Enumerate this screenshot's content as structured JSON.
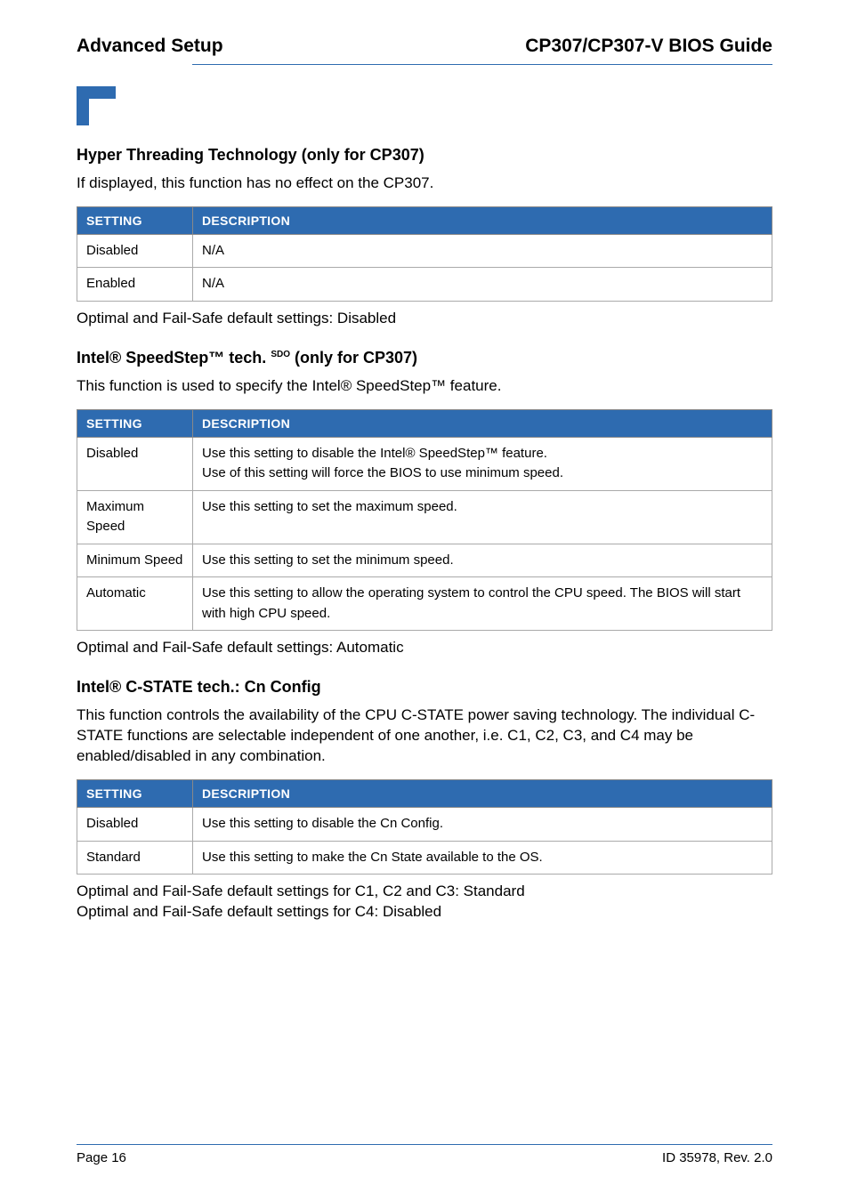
{
  "header": {
    "left": "Advanced Setup",
    "right": "CP307/CP307-V BIOS Guide"
  },
  "section1": {
    "title": "Hyper Threading Technology (only for CP307)",
    "intro": "If displayed, this function has no effect on the CP307.",
    "th_setting": "Setting",
    "th_desc": "Description",
    "rows": [
      {
        "setting": "Disabled",
        "desc": "N/A"
      },
      {
        "setting": "Enabled",
        "desc": "N/A"
      }
    ],
    "after": "Optimal and Fail-Safe default settings: Disabled"
  },
  "section2": {
    "title_pre": "Intel® SpeedStep™ tech. ",
    "title_sup": "SDO",
    "title_post": "  (only for CP307)",
    "intro": "This function is used to specify the Intel® SpeedStep™ feature.",
    "th_setting": "Setting",
    "th_desc": "Description",
    "rows": [
      {
        "setting": "Disabled",
        "desc": "Use this setting to disable the Intel® SpeedStep™ feature.\nUse of this setting will force the BIOS to use minimum speed."
      },
      {
        "setting": "Maximum Speed",
        "desc": "Use this setting to set the maximum speed."
      },
      {
        "setting": "Minimum Speed",
        "desc": "Use this setting to set the minimum speed."
      },
      {
        "setting": "Automatic",
        "desc": "Use this setting to allow the operating system to control the CPU speed. The BIOS will start with high CPU speed."
      }
    ],
    "after": "Optimal and Fail-Safe default settings: Automatic"
  },
  "section3": {
    "title": "Intel® C-STATE tech.: Cn Config",
    "intro": "This function controls the availability of the CPU C-STATE power saving technology. The individual C-STATE functions are selectable independent of one another, i.e. C1, C2, C3, and C4 may be enabled/disabled in any combination.",
    "th_setting": "Setting",
    "th_desc": "Description",
    "rows": [
      {
        "setting": "Disabled",
        "desc": "Use this setting to disable the Cn Config."
      },
      {
        "setting": "Standard",
        "desc": "Use this setting to make the Cn State available to the OS."
      }
    ],
    "after1": "Optimal and Fail-Safe default settings for C1, C2 and C3: Standard",
    "after2": "Optimal and Fail-Safe default settings for C4: Disabled"
  },
  "footer": {
    "left": "Page 16",
    "right": "ID 35978, Rev. 2.0"
  }
}
